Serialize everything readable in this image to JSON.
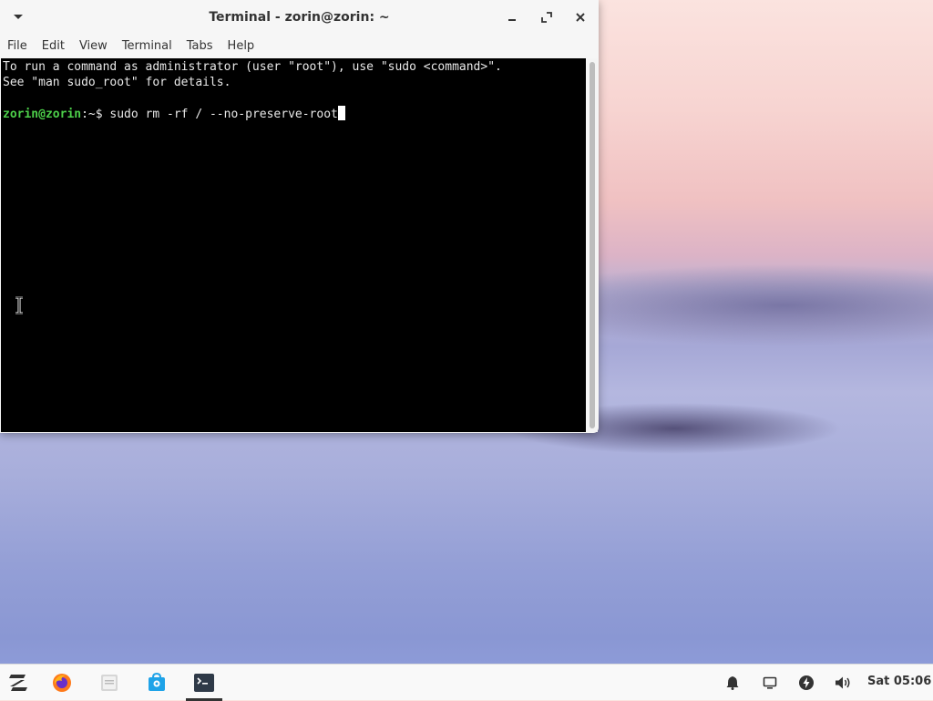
{
  "window": {
    "title": "Terminal - zorin@zorin: ~",
    "menu": [
      "File",
      "Edit",
      "View",
      "Terminal",
      "Tabs",
      "Help"
    ]
  },
  "terminal": {
    "lines": [
      "To run a command as administrator (user \"root\"), use \"sudo <command>\".",
      "See \"man sudo_root\" for details."
    ],
    "prompt_user": "zorin@zorin",
    "prompt_path": ":~$ ",
    "command": "sudo rm -rf / --no-preserve-root"
  },
  "taskbar": {
    "apps": [
      "zorin-menu-icon",
      "firefox-icon",
      "files-icon",
      "software-store-icon",
      "terminal-icon"
    ],
    "tray": [
      "bell-icon",
      "display-icon",
      "power-icon",
      "volume-icon"
    ],
    "clock": "Sat 05:06"
  },
  "colors": {
    "prompt_green": "#4dd04a",
    "terminal_bg": "#000000"
  }
}
